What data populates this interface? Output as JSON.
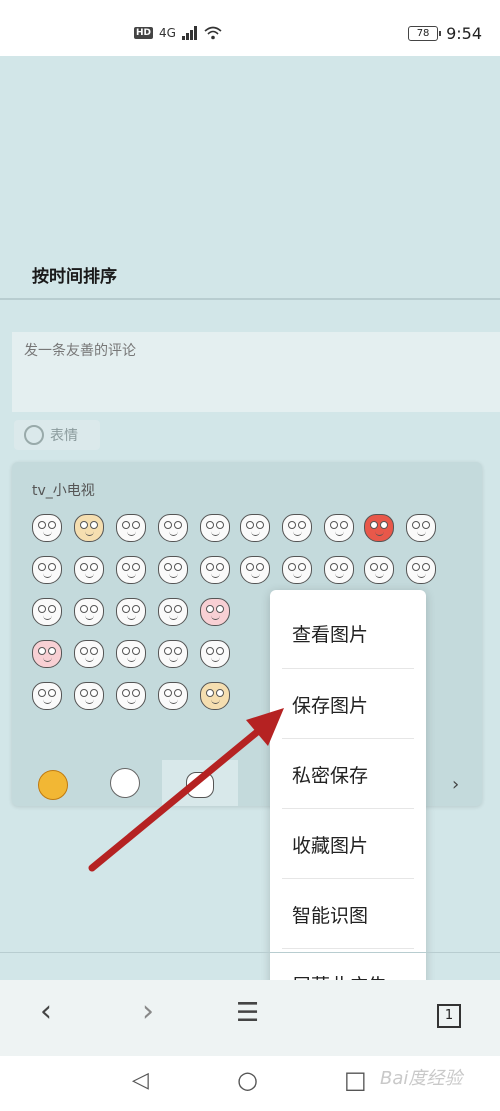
{
  "status": {
    "network": "4G",
    "battery": "78",
    "time": "9:54"
  },
  "page": {
    "sort_label": "按时间排序",
    "comment_placeholder": "发一条友善的评论",
    "emoji_button_label": "表情"
  },
  "emoji_panel": {
    "title": "tv_小电视",
    "next_label": "›"
  },
  "context_menu": {
    "items": [
      "查看图片",
      "保存图片",
      "私密保存",
      "收藏图片",
      "智能识图",
      "屏蔽此广告"
    ]
  },
  "toolbar": {
    "back": "‹",
    "forward": "›",
    "menu": "☰",
    "tab_count": "1"
  },
  "navbar": {
    "back": "◁",
    "home": "○",
    "recents": "□"
  },
  "watermark": "Bai度经验"
}
